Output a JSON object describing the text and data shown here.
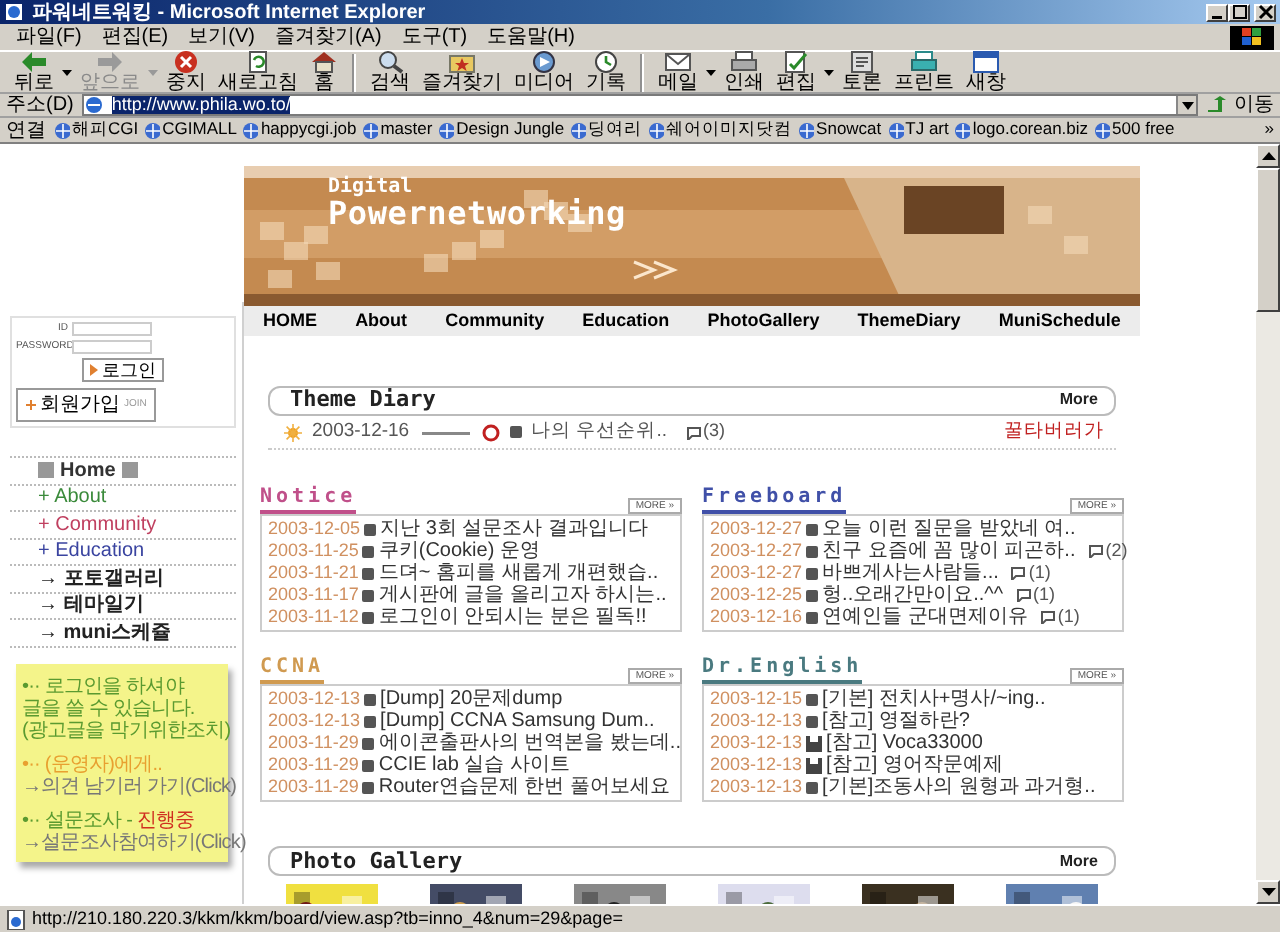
{
  "window": {
    "title": "파워네트워킹 - Microsoft Internet Explorer"
  },
  "menu": [
    "파일(F)",
    "편집(E)",
    "보기(V)",
    "즐겨찾기(A)",
    "도구(T)",
    "도움말(H)"
  ],
  "toolbar": [
    {
      "label": "뒤로",
      "kind": "back",
      "disabled": false,
      "dropdown": true
    },
    {
      "label": "앞으로",
      "kind": "forward",
      "disabled": true,
      "dropdown": true
    },
    {
      "label": "중지",
      "kind": "stop",
      "disabled": false,
      "dropdown": false
    },
    {
      "label": "새로고침",
      "kind": "refresh",
      "disabled": false,
      "dropdown": false
    },
    {
      "label": "홈",
      "kind": "home",
      "disabled": false,
      "dropdown": false
    },
    {
      "kind": "separator"
    },
    {
      "label": "검색",
      "kind": "search",
      "disabled": false,
      "dropdown": false
    },
    {
      "label": "즐겨찾기",
      "kind": "favorites",
      "disabled": false,
      "dropdown": false
    },
    {
      "label": "미디어",
      "kind": "media",
      "disabled": false,
      "dropdown": false
    },
    {
      "label": "기록",
      "kind": "history",
      "disabled": false,
      "dropdown": false
    },
    {
      "kind": "separator"
    },
    {
      "label": "메일",
      "kind": "mail",
      "disabled": false,
      "dropdown": true
    },
    {
      "label": "인쇄",
      "kind": "print",
      "disabled": false,
      "dropdown": false
    },
    {
      "label": "편집",
      "kind": "edit",
      "disabled": false,
      "dropdown": true
    },
    {
      "label": "토론",
      "kind": "discuss",
      "disabled": false,
      "dropdown": false
    },
    {
      "label": "프린트",
      "kind": "printer",
      "disabled": false,
      "dropdown": false
    },
    {
      "label": "새창",
      "kind": "window",
      "disabled": false,
      "dropdown": false
    }
  ],
  "address": {
    "label": "주소(D)",
    "value": "http://www.phila.wo.to/",
    "go": "이동"
  },
  "links": {
    "label": "연결",
    "items": [
      "해피CGI",
      "CGIMALL",
      "happycgi.job",
      "master",
      "Design Jungle",
      "딩여리",
      "쉐어이미지닷컴",
      "Snowcat",
      "TJ art",
      "logo.corean.biz",
      "500 free"
    ],
    "more": "»"
  },
  "banner": {
    "kicker": "Digital",
    "title": "Powernetworking"
  },
  "nav": [
    "HOME",
    "About",
    "Community",
    "Education",
    "PhotoGallery",
    "ThemeDiary",
    "MuniSchedule"
  ],
  "login": {
    "id_label": "ID",
    "password_label": "PASSWORD",
    "button": "로그인",
    "join": "회원가입",
    "join_sub": "JOIN"
  },
  "sidebar_menu": [
    {
      "label": "Home",
      "kind": "home",
      "color": "#333333"
    },
    {
      "label": "+ About",
      "kind": "link",
      "color": "#3a8a3a"
    },
    {
      "label": "+ Community",
      "kind": "link",
      "color": "#c04060"
    },
    {
      "label": "+ Education",
      "kind": "link",
      "color": "#3a44a0"
    },
    {
      "label": "→ 포토갤러리",
      "kind": "bold",
      "color": "#222222"
    },
    {
      "label": "→ 테마일기",
      "kind": "bold",
      "color": "#222222"
    },
    {
      "label": "→ muni스케쥴",
      "kind": "bold",
      "color": "#222222"
    }
  ],
  "note": [
    {
      "parts": [
        {
          "text": "•·· 로그인을 하셔야",
          "kind": "info"
        }
      ]
    },
    {
      "parts": [
        {
          "text": "글을 쓸 수 있습니다.",
          "kind": "info"
        }
      ]
    },
    {
      "parts": [
        {
          "text": "(광고글을 막기위한조치)",
          "kind": "info"
        }
      ]
    },
    {
      "parts": [
        {
          "text": "•·· (운영자)에게..",
          "kind": "highlight"
        }
      ],
      "gap": true
    },
    {
      "parts": [
        {
          "text": "→의견 남기러 가기(Click)",
          "kind": "link"
        }
      ]
    },
    {
      "parts": [
        {
          "text": "•·· 설문조사 - ",
          "kind": "info"
        },
        {
          "text": "진행중",
          "kind": "alert"
        }
      ],
      "gap": true
    },
    {
      "parts": [
        {
          "text": "→설문조사참여하기(Click)",
          "kind": "link"
        }
      ]
    }
  ],
  "theme_diary": {
    "title": "Theme Diary",
    "more": "More",
    "entry": {
      "date": "2003-12-16",
      "title": "나의 우선순위..",
      "comments": "(3)",
      "author": "꿀타버러가"
    }
  },
  "boards": [
    {
      "title": "Notice",
      "color": "#c0508a",
      "more": "MORE »",
      "rows": [
        {
          "date": "2003-12-05",
          "title": "지난 3회 설문조사 결과입니다"
        },
        {
          "date": "2003-11-25",
          "title": "쿠키(Cookie) 운영"
        },
        {
          "date": "2003-11-21",
          "title": "드뎌~ 홈피를 새롭게 개편했습.."
        },
        {
          "date": "2003-11-17",
          "title": "게시판에 글을 올리고자 하시는.."
        },
        {
          "date": "2003-11-12",
          "title": "로그인이 안되시는 분은 필독!!"
        }
      ]
    },
    {
      "title": "Freeboard",
      "color": "#4050a8",
      "more": "MORE »",
      "rows": [
        {
          "date": "2003-12-27",
          "title": "오늘 이런 질문을 받았네 여.."
        },
        {
          "date": "2003-12-27",
          "title": "친구 요즘에 꼼 많이 피곤하..",
          "comments": "(2)"
        },
        {
          "date": "2003-12-27",
          "title": "바쁘게사는사람들...",
          "comments": "(1)"
        },
        {
          "date": "2003-12-25",
          "title": "헝..오래간만이요..^^",
          "comments": "(1)"
        },
        {
          "date": "2003-12-16",
          "title": "연예인들 군대면제이유",
          "comments": "(1)"
        }
      ]
    },
    {
      "title": "CCNA",
      "color": "#d09a50",
      "more": "MORE »",
      "rows": [
        {
          "date": "2003-12-13",
          "title": "[Dump] 20문제dump"
        },
        {
          "date": "2003-12-13",
          "title": "[Dump] CCNA Samsung Dum.."
        },
        {
          "date": "2003-11-29",
          "title": "에이콘출판사의 번역본을 봤는데.."
        },
        {
          "date": "2003-11-29",
          "title": "CCIE lab 실습 사이트"
        },
        {
          "date": "2003-11-29",
          "title": "Router연습문제 한번 풀어보세요"
        }
      ]
    },
    {
      "title": "Dr.English",
      "color": "#4a7a80",
      "more": "MORE »",
      "rows": [
        {
          "date": "2003-12-15",
          "title": "[기본] 전치사+명사/~ing..",
          "kind": "bullet"
        },
        {
          "date": "2003-12-13",
          "title": "[참고] 영절하란?",
          "kind": "bullet"
        },
        {
          "date": "2003-12-13",
          "title": "[참고] Voca33000",
          "kind": "disk"
        },
        {
          "date": "2003-12-13",
          "title": "[참고] 영어작문예제",
          "kind": "disk"
        },
        {
          "date": "2003-12-13",
          "title": "[기본]조동사의 원형과 과거형..",
          "kind": "bullet"
        }
      ]
    }
  ],
  "photo_gallery": {
    "title": "Photo Gallery",
    "more": "More"
  },
  "status_bar": {
    "text": "http://210.180.220.3/kkm/kkm/board/view.asp?tb=inno_4&num=29&page="
  }
}
